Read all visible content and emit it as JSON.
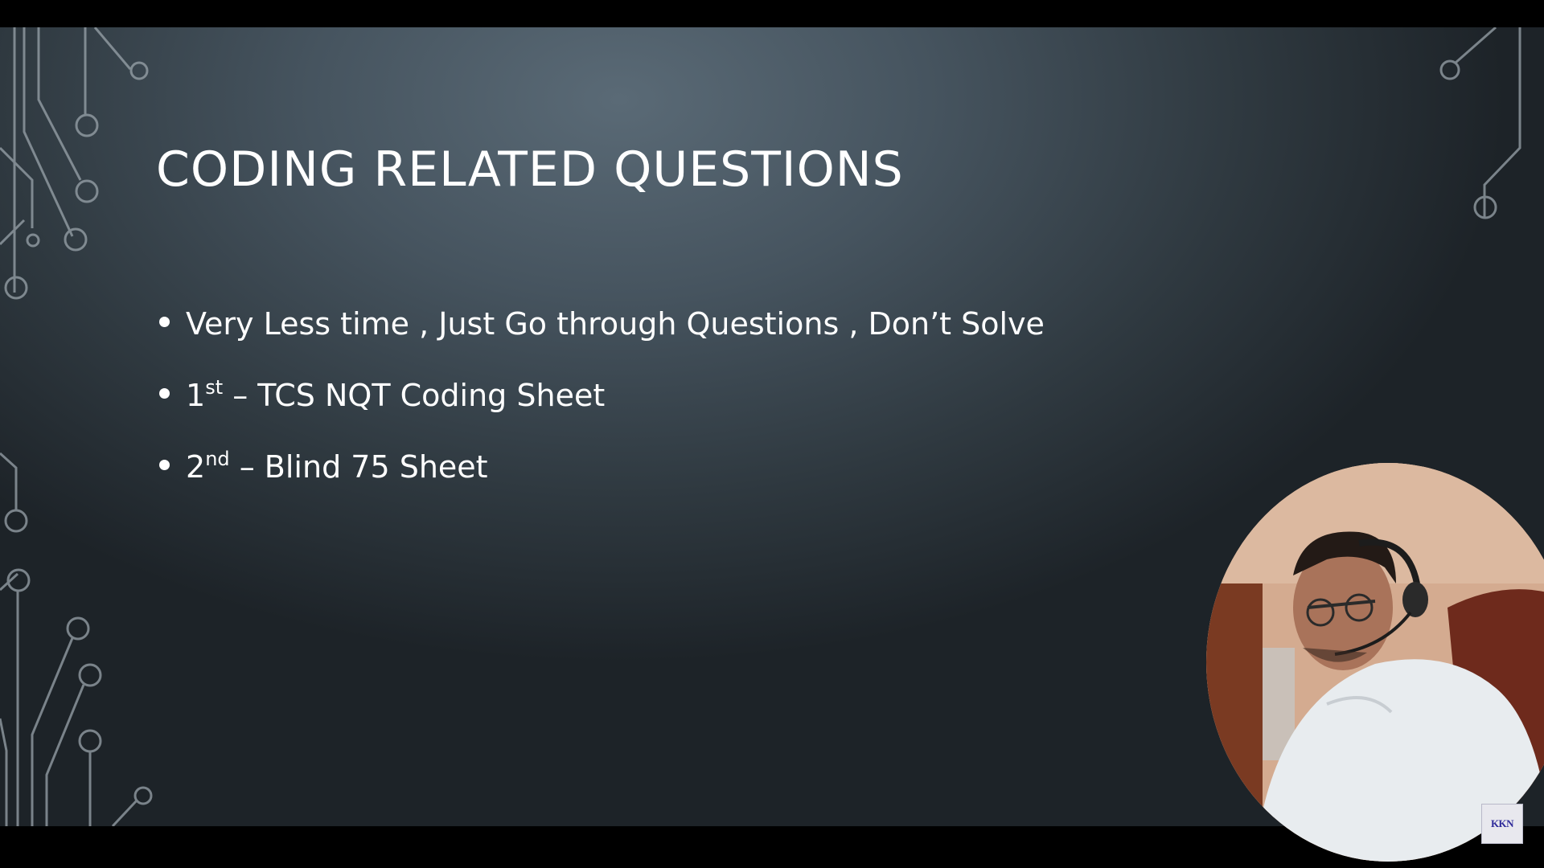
{
  "slide": {
    "title": "CODING RELATED QUESTIONS",
    "bullets": [
      {
        "text": "Very Less time , Just Go through Questions , Don’t Solve"
      },
      {
        "num": "1",
        "sup": "st",
        "rest": " – TCS NQT Coding Sheet"
      },
      {
        "num": "2",
        "sup": "nd",
        "rest": " – Blind 75 Sheet"
      }
    ]
  },
  "webcam": {
    "badge": "KKN"
  },
  "colors": {
    "background_center": "#5a6a76",
    "background_edge": "#1d2328",
    "text": "#ffffff",
    "circuit": "#9aa4ab"
  }
}
